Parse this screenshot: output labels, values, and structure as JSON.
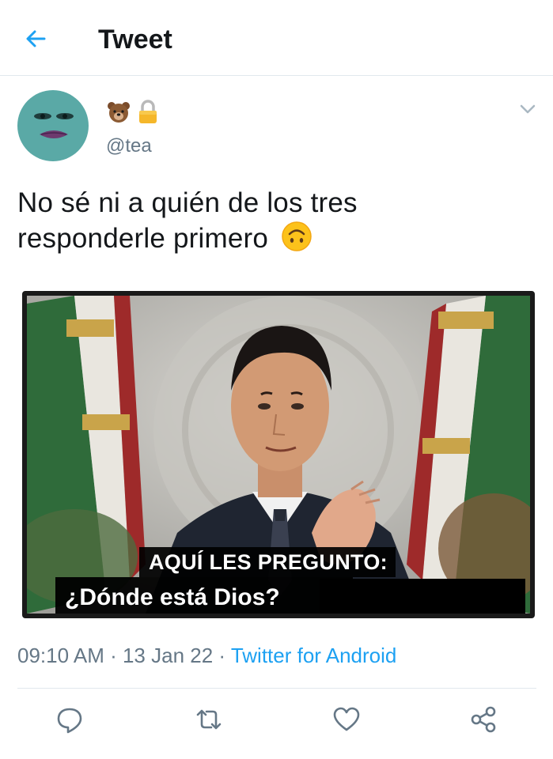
{
  "header": {
    "back_icon": "arrow-left-icon",
    "title": "Tweet",
    "accent_color": "#1da1f2"
  },
  "tweet": {
    "display_name_icons": [
      "bear-face-emoji",
      "lock-icon"
    ],
    "handle": "@tea",
    "text_line_1": "No sé ni a quién de los tres",
    "text_line_2": "responderle primero",
    "text_emoji": "upside-down-face-emoji",
    "media": {
      "caption_top": "AQUÍ LES PREGUNTO:",
      "caption_bottom": "¿Dónde está  Dios?"
    },
    "time": "09:10 AM",
    "separator": " · ",
    "date": "13 Jan 22",
    "source": "Twitter for Android"
  },
  "actions": {
    "icons": [
      "reply-icon",
      "retweet-icon",
      "like-icon",
      "share-icon"
    ]
  }
}
